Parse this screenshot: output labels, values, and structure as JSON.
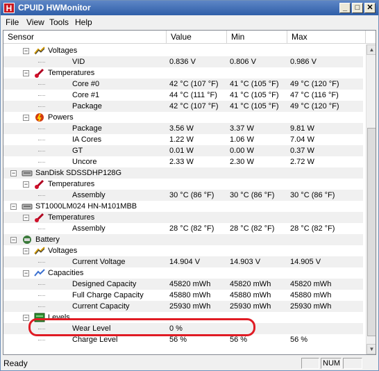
{
  "window": {
    "icon_letter": "H",
    "title": "CPUID HWMonitor",
    "minimize_glyph": "_",
    "maximize_glyph": "□",
    "close_glyph": "✕"
  },
  "menu": [
    "File",
    "View",
    "Tools",
    "Help"
  ],
  "columns": [
    "Sensor",
    "Value",
    "Min",
    "Max"
  ],
  "rows": [
    {
      "label": "Voltages",
      "kind": "group",
      "icon": "voltage-icon",
      "value": "",
      "min": "",
      "max": ""
    },
    {
      "label": "VID",
      "kind": "leaf",
      "value": "0.836 V",
      "min": "0.806 V",
      "max": "0.986 V"
    },
    {
      "label": "Temperatures",
      "kind": "group",
      "icon": "thermometer-icon",
      "value": "",
      "min": "",
      "max": ""
    },
    {
      "label": "Core #0",
      "kind": "leaf",
      "value": "42 °C  (107 °F)",
      "min": "41 °C  (105 °F)",
      "max": "49 °C  (120 °F)"
    },
    {
      "label": "Core #1",
      "kind": "leaf",
      "value": "44 °C  (111 °F)",
      "min": "41 °C  (105 °F)",
      "max": "47 °C  (116 °F)"
    },
    {
      "label": "Package",
      "kind": "leaf",
      "value": "42 °C  (107 °F)",
      "min": "41 °C  (105 °F)",
      "max": "49 °C  (120 °F)"
    },
    {
      "label": "Powers",
      "kind": "group",
      "icon": "power-icon",
      "value": "",
      "min": "",
      "max": ""
    },
    {
      "label": "Package",
      "kind": "leaf",
      "value": "3.56 W",
      "min": "3.37 W",
      "max": "9.81 W"
    },
    {
      "label": "IA Cores",
      "kind": "leaf",
      "value": "1.22 W",
      "min": "1.06 W",
      "max": "7.04 W"
    },
    {
      "label": "GT",
      "kind": "leaf",
      "value": "0.01 W",
      "min": "0.00 W",
      "max": "0.37 W"
    },
    {
      "label": "Uncore",
      "kind": "leaf",
      "value": "2.33 W",
      "min": "2.30 W",
      "max": "2.72 W"
    },
    {
      "label": "SanDisk SDSSDHP128G",
      "kind": "device",
      "icon": "drive-icon",
      "value": "",
      "min": "",
      "max": ""
    },
    {
      "label": "Temperatures",
      "kind": "group",
      "icon": "thermometer-icon",
      "value": "",
      "min": "",
      "max": ""
    },
    {
      "label": "Assembly",
      "kind": "leaf",
      "value": "30 °C  (86 °F)",
      "min": "30 °C  (86 °F)",
      "max": "30 °C  (86 °F)"
    },
    {
      "label": "ST1000LM024 HN-M101MBB",
      "kind": "device",
      "icon": "drive-icon",
      "value": "",
      "min": "",
      "max": ""
    },
    {
      "label": "Temperatures",
      "kind": "group",
      "icon": "thermometer-icon",
      "value": "",
      "min": "",
      "max": ""
    },
    {
      "label": "Assembly",
      "kind": "leaf",
      "value": "28 °C  (82 °F)",
      "min": "28 °C  (82 °F)",
      "max": "28 °C  (82 °F)"
    },
    {
      "label": "Battery",
      "kind": "device",
      "icon": "battery-icon",
      "value": "",
      "min": "",
      "max": ""
    },
    {
      "label": "Voltages",
      "kind": "group",
      "icon": "voltage-icon",
      "value": "",
      "min": "",
      "max": ""
    },
    {
      "label": "Current Voltage",
      "kind": "leaf",
      "value": "14.904 V",
      "min": "14.903 V",
      "max": "14.905 V"
    },
    {
      "label": "Capacities",
      "kind": "group",
      "icon": "capacity-icon",
      "value": "",
      "min": "",
      "max": ""
    },
    {
      "label": "Designed Capacity",
      "kind": "leaf",
      "value": "45820 mWh",
      "min": "45820 mWh",
      "max": "45820 mWh"
    },
    {
      "label": "Full Charge Capacity",
      "kind": "leaf",
      "value": "45880 mWh",
      "min": "45880 mWh",
      "max": "45880 mWh"
    },
    {
      "label": "Current Capacity",
      "kind": "leaf",
      "value": "25930 mWh",
      "min": "25930 mWh",
      "max": "25930 mWh"
    },
    {
      "label": "Levels",
      "kind": "group",
      "icon": "levels-icon",
      "value": "",
      "min": "",
      "max": ""
    },
    {
      "label": "Wear Level",
      "kind": "leaf",
      "value": "0 %",
      "min": "",
      "max": ""
    },
    {
      "label": "Charge Level",
      "kind": "leaf",
      "value": "56 %",
      "min": "56 %",
      "max": "56 %"
    }
  ],
  "status": {
    "text": "Ready",
    "num": "NUM"
  },
  "colors": {
    "highlight": "#e01b24"
  }
}
